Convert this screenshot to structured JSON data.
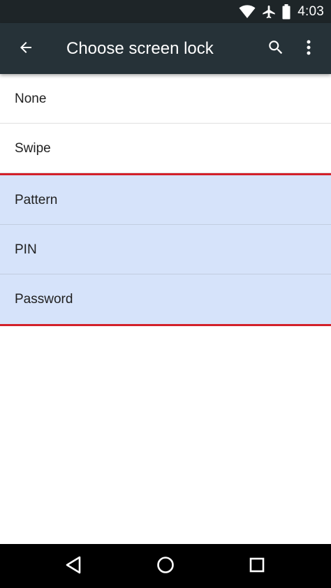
{
  "status_bar": {
    "time": "4:03",
    "icons": [
      "wifi-icon",
      "airplane-icon",
      "battery-icon"
    ]
  },
  "toolbar": {
    "title": "Choose screen lock",
    "back_icon": "arrow-back-icon",
    "search_icon": "search-icon",
    "more_icon": "more-vert-icon"
  },
  "lock_options": [
    {
      "label": "None",
      "highlighted": false
    },
    {
      "label": "Swipe",
      "highlighted": false
    },
    {
      "label": "Pattern",
      "highlighted": true
    },
    {
      "label": "PIN",
      "highlighted": true
    },
    {
      "label": "Password",
      "highlighted": true
    }
  ],
  "nav_bar": {
    "buttons": [
      "back-triangle-icon",
      "home-circle-icon",
      "recents-square-icon"
    ]
  },
  "colors": {
    "toolbar": "#263238",
    "status_bar": "#1e2528",
    "highlight_fill": "#d6e3fa",
    "highlight_border": "#d3202a"
  }
}
